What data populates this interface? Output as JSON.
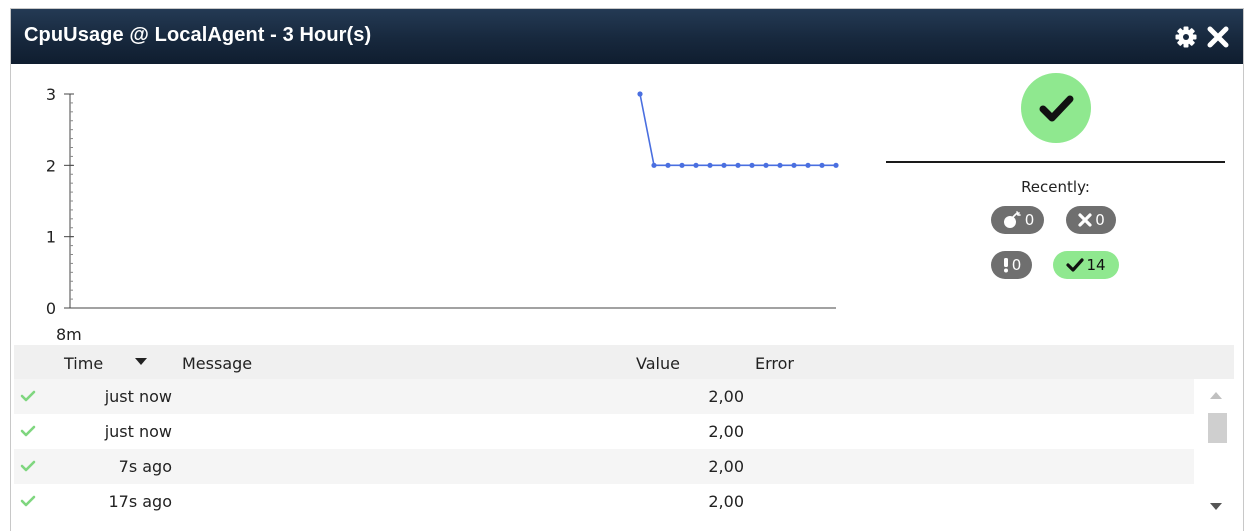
{
  "widget": {
    "title": "CpuUsage @ LocalAgent - 3 Hour(s)",
    "icons": [
      "gear-icon",
      "close-icon"
    ]
  },
  "chart_data": {
    "type": "line",
    "title": "",
    "xlabel": "",
    "ylabel": "",
    "x_tick_labels": [
      "8m"
    ],
    "y_ticks": [
      0,
      1,
      2,
      3
    ],
    "ylim": [
      0,
      3
    ],
    "series": [
      {
        "values": [
          3,
          2,
          2,
          2,
          2,
          2,
          2,
          2,
          2,
          2,
          2,
          2,
          2,
          2,
          2
        ],
        "color": "#4a6fe0"
      }
    ],
    "grid": false,
    "legend": "none"
  },
  "status": {
    "state": "ok",
    "icon": "check-icon",
    "color": "#8fe88f",
    "recently_label": "Recently:",
    "counters": [
      {
        "icon": "bomb-icon",
        "count": "0"
      },
      {
        "icon": "x-icon",
        "count": "0"
      },
      {
        "icon": "exclamation-icon",
        "count": "0"
      },
      {
        "icon": "check-icon",
        "count": "14",
        "highlight": true
      }
    ]
  },
  "grid": {
    "columns": [
      "Time",
      "Message",
      "Value",
      "Error"
    ],
    "sort_column": "Time",
    "sort_direction": "desc",
    "rows": [
      {
        "status": "ok",
        "time": "just now",
        "message": "",
        "value": "2,00",
        "error": ""
      },
      {
        "status": "ok",
        "time": "just now",
        "message": "",
        "value": "2,00",
        "error": ""
      },
      {
        "status": "ok",
        "time": "7s ago",
        "message": "",
        "value": "2,00",
        "error": ""
      },
      {
        "status": "ok",
        "time": "17s ago",
        "message": "",
        "value": "2,00",
        "error": ""
      }
    ]
  }
}
